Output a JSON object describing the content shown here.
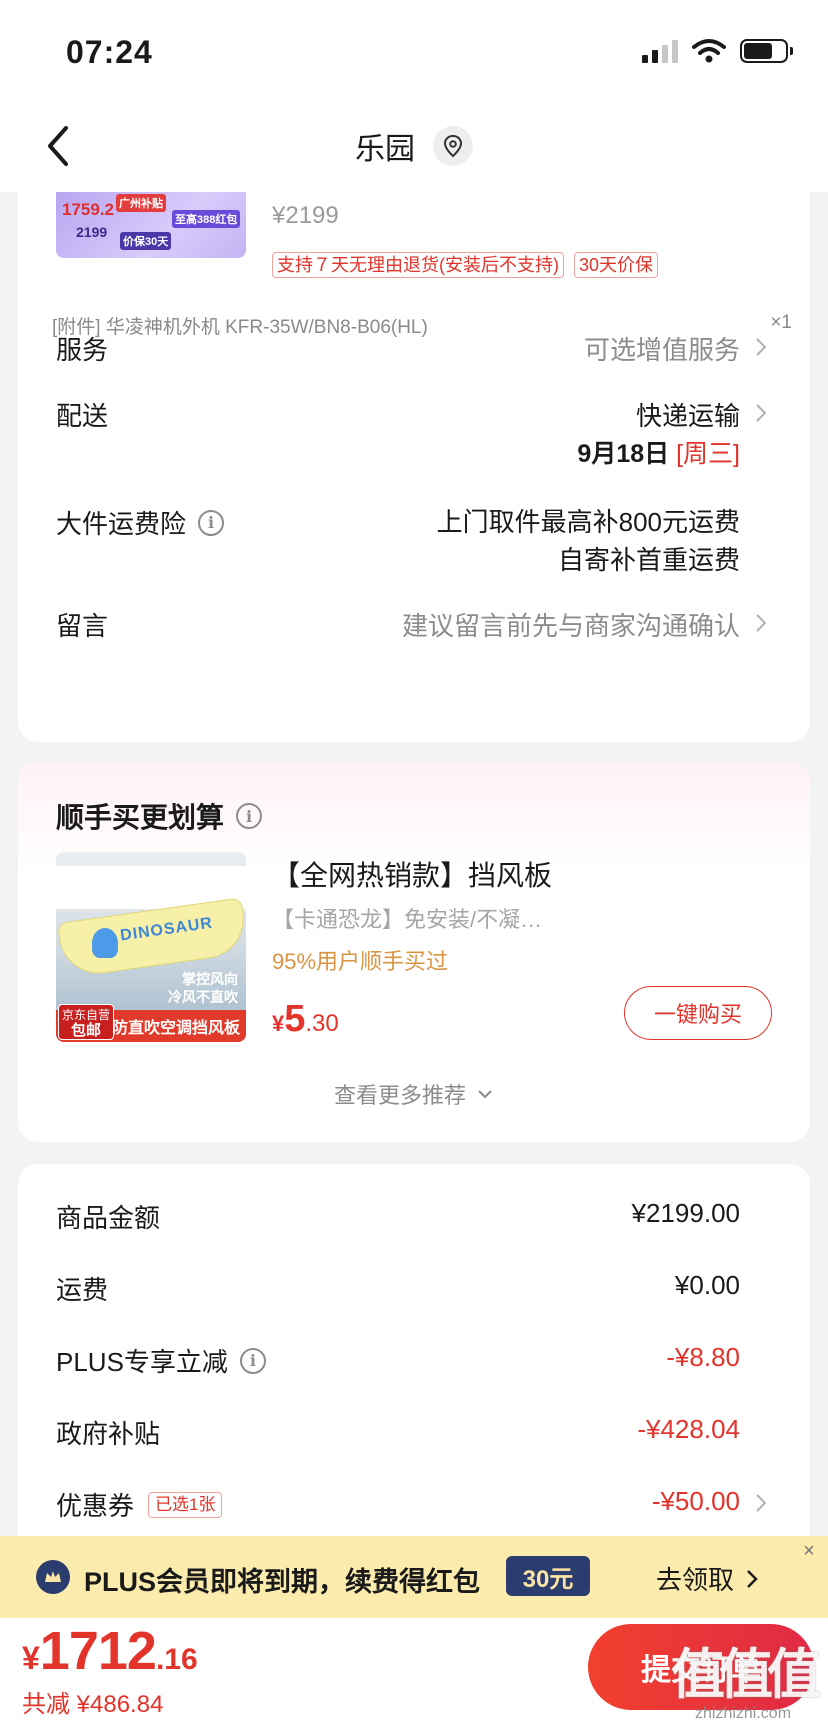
{
  "status_bar": {
    "time": "07:24"
  },
  "nav": {
    "title": "乐园"
  },
  "product": {
    "thumb": {
      "tag_text": "广州补贴",
      "price_a": "1759.2",
      "price_b": "2199",
      "promo": "至高388红包",
      "promo2": "价保30天"
    },
    "price": "¥2199",
    "tags": [
      "支持７天无理由退货(安装后不支持)",
      "30天价保"
    ],
    "attachment": {
      "text": "[附件] 华凌神机外机 KFR-35W/BN8-B06(HL)",
      "qty": "×1"
    }
  },
  "rows": {
    "service": {
      "label": "服务",
      "value": "可选增值服务"
    },
    "delivery": {
      "label": "配送",
      "value": "快递运输",
      "date": "9月18日",
      "weekday": "[周三]"
    },
    "shipping_insurance": {
      "label": "大件运费险",
      "line1": "上门取件最高补800元运费",
      "line2": "自寄补首重运费"
    },
    "message": {
      "label": "留言",
      "value": "建议留言前先与商家沟通确认"
    }
  },
  "recommend": {
    "title": "顺手买更划算",
    "item": {
      "title": "【全网热销款】挡风板",
      "subtitle": "【卡通恐龙】免安装/不凝…",
      "stat": "95%用户顺手买过",
      "price_currency": "¥",
      "price_int": "5",
      "price_dec": ".30",
      "buy_label": "一键购买",
      "img_board_text": "DINOSAUR",
      "img_bottom_text": "防直吹空调挡风板",
      "img_badge_line1": "京东自营",
      "img_badge_line2": "包邮",
      "img_side_text1": "掌控风向",
      "img_side_text2": "冷风不直吹"
    },
    "more_label": "查看更多推荐"
  },
  "summary": {
    "goods_amount": {
      "label": "商品金额",
      "value": "¥2199.00"
    },
    "freight": {
      "label": "运费",
      "value": "¥0.00"
    },
    "plus_discount": {
      "label": "PLUS专享立减",
      "value": "-¥8.80"
    },
    "gov_subsidy": {
      "label": "政府补贴",
      "value": "-¥428.04"
    },
    "coupon": {
      "label": "优惠券",
      "badge": "已选1张",
      "value": "-¥50.00"
    }
  },
  "plus_banner": {
    "text": "PLUS会员即将到期，续费得红包",
    "amount": "30元",
    "action": "去领取"
  },
  "bottom": {
    "total_currency": "¥",
    "total_int": "1712",
    "total_dec": ".16",
    "saved": "共减 ¥486.84",
    "submit_label": "提交订单"
  },
  "watermark": {
    "main": "值值值",
    "sub": "zhizhizhi.com"
  },
  "colors": {
    "accent_red": "#e2342a",
    "plus_navy": "#2b3c6e",
    "banner_bg": "#fbecae"
  }
}
